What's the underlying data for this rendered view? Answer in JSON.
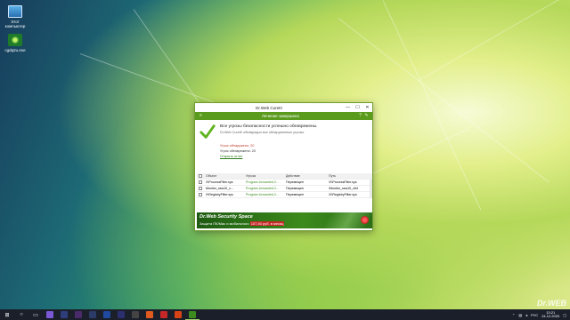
{
  "desktop": {
    "icons": [
      {
        "label": "Этот компьютер",
        "icon": "computer-icon"
      },
      {
        "label": "cgdq2u.exe",
        "icon": "cureit-icon"
      }
    ],
    "watermark": "Dr.WEB"
  },
  "window": {
    "title": "Dr.Web CureIt!",
    "controls": {
      "minimize": "—",
      "maximize": "☐",
      "close": "✕"
    },
    "toolbar_title": "Лечение завершено",
    "status_title": "Все угрозы безопасности успешно обезврежены.",
    "status_subtitle": "Dr.Web CureIt! обезвредил все обнаруженные угрозы.",
    "threats_found": "Угроз обнаружено: 20",
    "threats_fixed": "Угроз обезврежено: 20",
    "report_link": "Открыть отчет",
    "table": {
      "headers": [
        "Объект",
        "Угроза",
        "Действие",
        "Путь"
      ],
      "rows": [
        [
          "X\\ProcessFilter.sys",
          "Program.Unwanted.2...",
          "Перемещен",
          "\\X\\ProcessFilter.sys"
        ],
        [
          "Monitor_ssw10_x...",
          "Program.Unwanted.2...",
          "Перемещен",
          "\\Monitor_ssw10_x64"
        ],
        [
          "X\\RegistryFilter.sys",
          "Program.Unwanted.2...",
          "Перемещен",
          "\\X\\RegistryFilter.sys"
        ]
      ]
    },
    "banner": {
      "title": "Dr.Web Security Space",
      "line_before": "Защита ПК/Mac и мобильного",
      "price": "107,50 руб. в месяц"
    }
  },
  "taskbar": {
    "tray_lang": "РУС",
    "time": "13:21",
    "date": "24.12.2020"
  },
  "colors": {
    "accent_green": "#5a9b1e",
    "threat_red": "#c0392b",
    "taskbar": "#1a1f2a"
  }
}
